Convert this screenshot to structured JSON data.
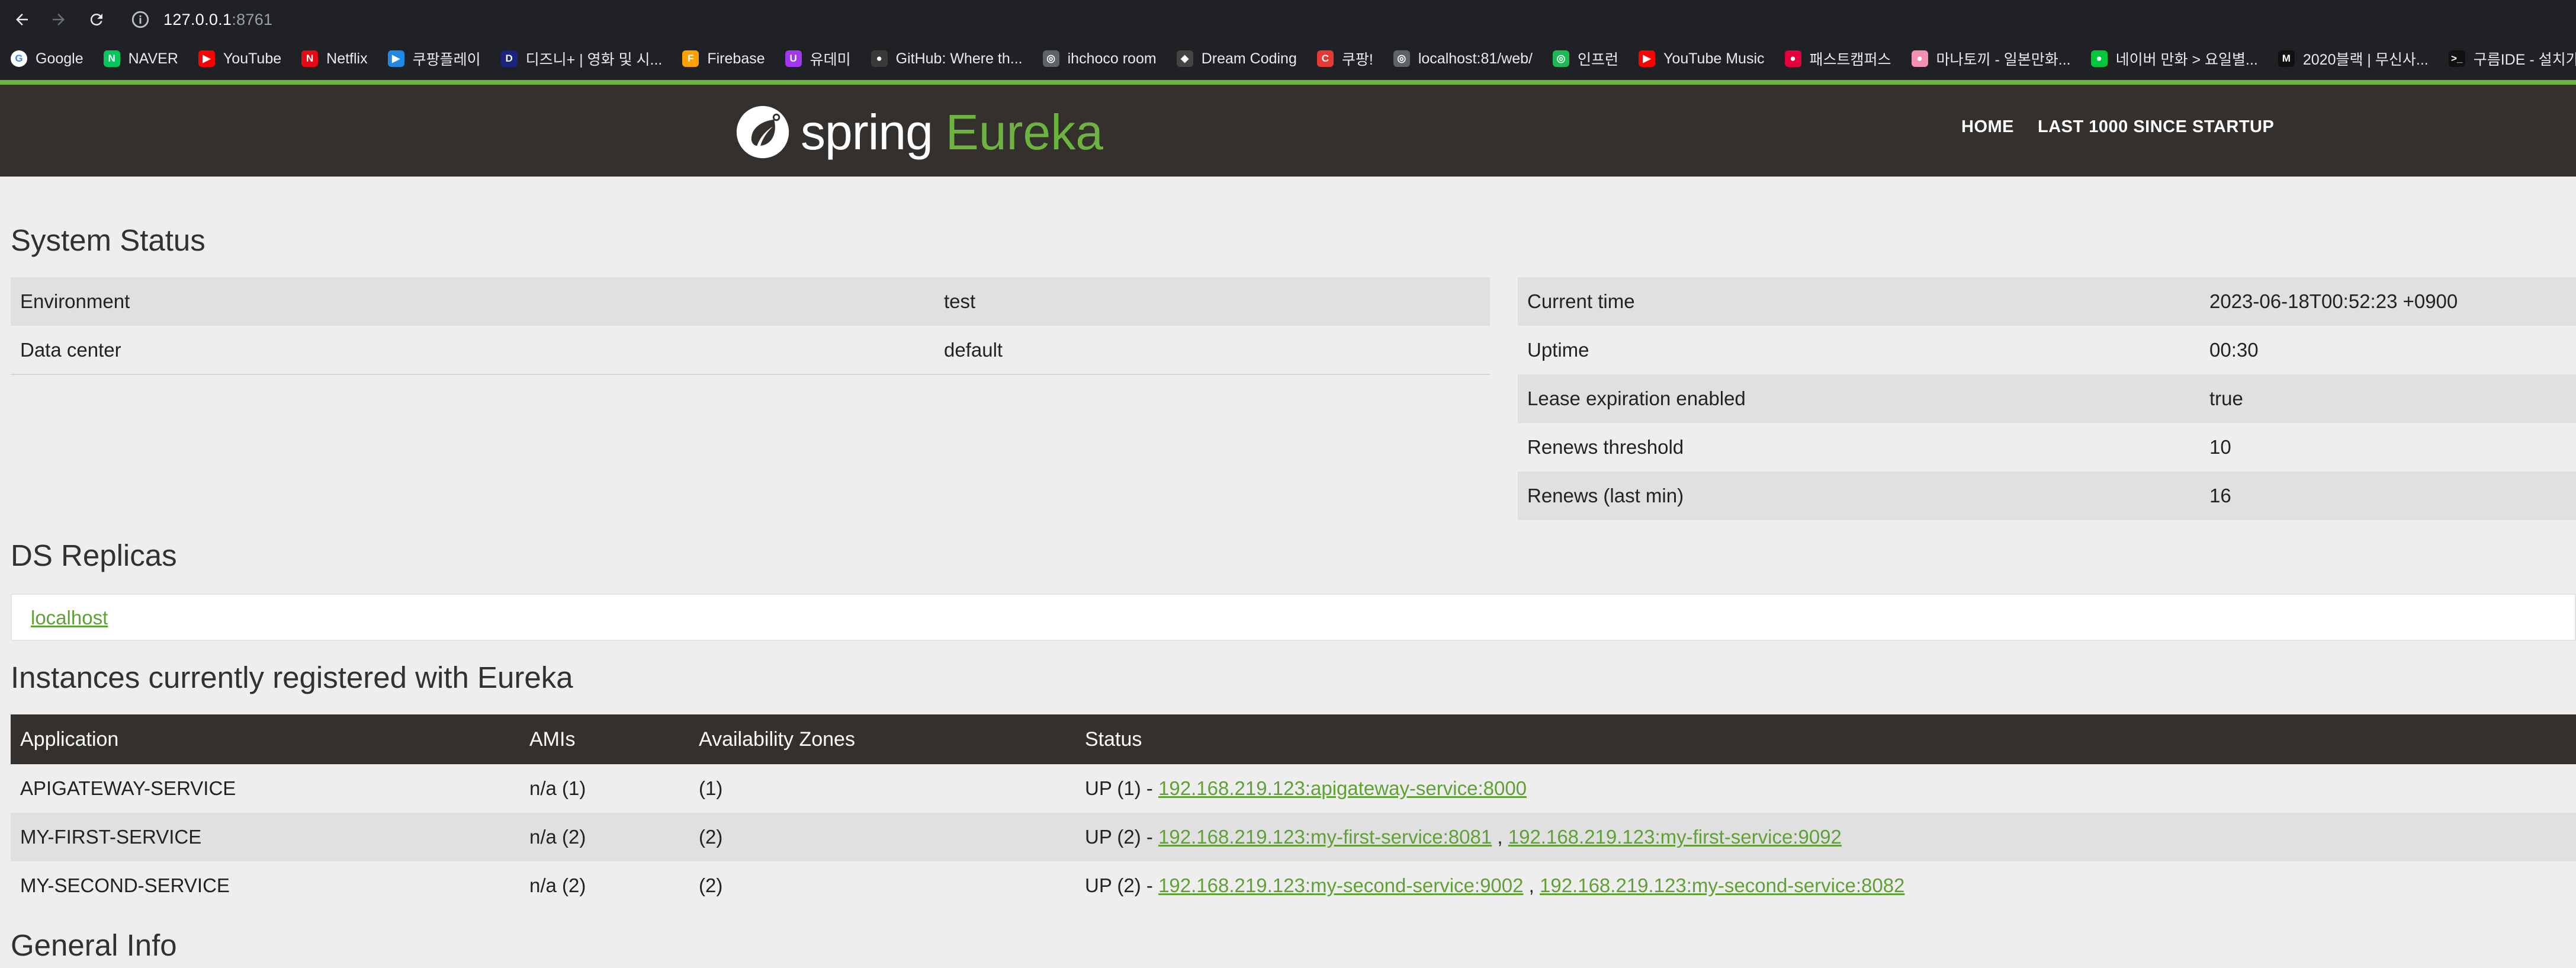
{
  "browser": {
    "url_host": "127.0.0.1",
    "url_port": ":8761",
    "bookmarks": [
      {
        "label": "Google",
        "icon": "google-icon",
        "color": "#ffffff",
        "glyph": "G"
      },
      {
        "label": "NAVER",
        "icon": "naver-icon",
        "color": "#03c75a",
        "glyph": "N"
      },
      {
        "label": "YouTube",
        "icon": "youtube-icon",
        "color": "#ff0000",
        "glyph": "▶"
      },
      {
        "label": "Netflix",
        "icon": "netflix-icon",
        "color": "#e50914",
        "glyph": "N"
      },
      {
        "label": "쿠팡플레이",
        "icon": "coupang-play-icon",
        "color": "#1e88e5",
        "glyph": "▶"
      },
      {
        "label": "디즈니+ | 영화 및 시...",
        "icon": "disney-icon",
        "color": "#1a237e",
        "glyph": "D"
      },
      {
        "label": "Firebase",
        "icon": "firebase-icon",
        "color": "#ffa000",
        "glyph": "F"
      },
      {
        "label": "유데미",
        "icon": "udemy-icon",
        "color": "#a435f0",
        "glyph": "U"
      },
      {
        "label": "GitHub: Where th...",
        "icon": "github-icon",
        "color": "#3a3a3a",
        "glyph": "●"
      },
      {
        "label": "ihchoco room",
        "icon": "globe-icon",
        "color": "#5f6368",
        "glyph": "◎"
      },
      {
        "label": "Dream Coding",
        "icon": "dream-coding-icon",
        "color": "#444444",
        "glyph": "◆"
      },
      {
        "label": "쿠팡!",
        "icon": "coupang-icon",
        "color": "#e53935",
        "glyph": "C"
      },
      {
        "label": "localhost:81/web/",
        "icon": "globe-icon",
        "color": "#5f6368",
        "glyph": "◎"
      },
      {
        "label": "인프런",
        "icon": "inflearn-icon",
        "color": "#1db954",
        "glyph": "◎"
      },
      {
        "label": "YouTube Music",
        "icon": "youtube-music-icon",
        "color": "#ff0000",
        "glyph": "▶"
      },
      {
        "label": "패스트캠퍼스",
        "icon": "fastcampus-icon",
        "color": "#e6003e",
        "glyph": "●"
      },
      {
        "label": "마나토끼 - 일본만화...",
        "icon": "manatoki-icon",
        "color": "#f48fb1",
        "glyph": "●"
      },
      {
        "label": "네이버 만화 > 요일별...",
        "icon": "naver-webtoon-icon",
        "color": "#00c73c",
        "glyph": "●"
      },
      {
        "label": "2020블랙 | 무신사...",
        "icon": "musinsa-icon",
        "color": "#111111",
        "glyph": "M"
      },
      {
        "label": "구름IDE - 설치가",
        "icon": "goorm-icon",
        "color": "#111111",
        "glyph": ">_"
      }
    ]
  },
  "header": {
    "logo_spring": "spring",
    "logo_eureka": "Eureka",
    "nav": [
      "HOME",
      "LAST 1000 SINCE STARTUP"
    ]
  },
  "system_status": {
    "title": "System Status",
    "left": [
      {
        "key": "Environment",
        "value": "test"
      },
      {
        "key": "Data center",
        "value": "default"
      }
    ],
    "right": [
      {
        "key": "Current time",
        "value": "2023-06-18T00:52:23 +0900"
      },
      {
        "key": "Uptime",
        "value": "00:30"
      },
      {
        "key": "Lease expiration enabled",
        "value": "true"
      },
      {
        "key": "Renews threshold",
        "value": "10"
      },
      {
        "key": "Renews (last min)",
        "value": "16"
      }
    ]
  },
  "ds_replicas": {
    "title": "DS Replicas",
    "link": "localhost"
  },
  "instances": {
    "title": "Instances currently registered with Eureka",
    "columns": [
      "Application",
      "AMIs",
      "Availability Zones",
      "Status"
    ],
    "rows": [
      {
        "app": "APIGATEWAY-SERVICE",
        "amis": "n/a (1)",
        "zones": "(1)",
        "status_prefix": "UP (1) - ",
        "links": [
          "192.168.219.123:apigateway-service:8000"
        ]
      },
      {
        "app": "MY-FIRST-SERVICE",
        "amis": "n/a (2)",
        "zones": "(2)",
        "status_prefix": "UP (2) - ",
        "links": [
          "192.168.219.123:my-first-service:8081",
          "192.168.219.123:my-first-service:9092"
        ]
      },
      {
        "app": "MY-SECOND-SERVICE",
        "amis": "n/a (2)",
        "zones": "(2)",
        "status_prefix": "UP (2) - ",
        "links": [
          "192.168.219.123:my-second-service:9002",
          "192.168.219.123:my-second-service:8082"
        ]
      }
    ]
  },
  "general_info": {
    "title": "General Info"
  }
}
